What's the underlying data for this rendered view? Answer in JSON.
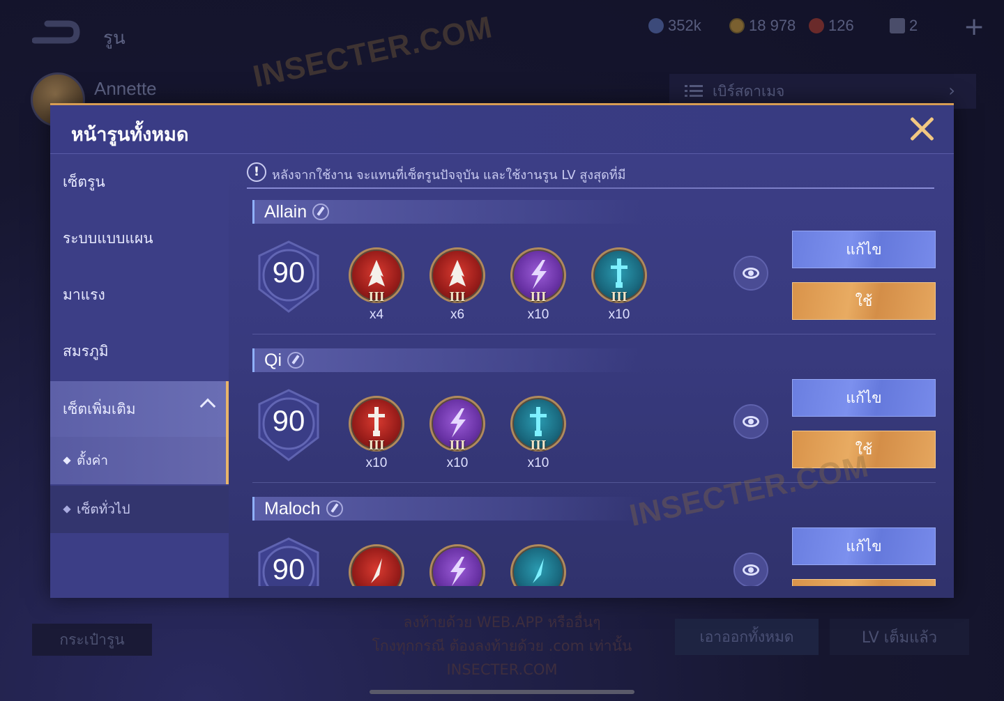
{
  "background": {
    "page_title": "รูน",
    "currencies": [
      {
        "icon": "crystal-icon",
        "value": "352k"
      },
      {
        "icon": "gold-coin-icon",
        "value": "18 978"
      },
      {
        "icon": "red-diamond-icon",
        "value": "126"
      },
      {
        "icon": "ticket-icon",
        "value": "2"
      }
    ],
    "plus_symbol": "+",
    "hero_name": "Annette",
    "mode_select_label": "เบิร์สดาเมจ",
    "bottom_left_button": "กระเป๋ารูน",
    "remove_all_button": "เอาออกทั้งหมด",
    "lv_full_button": "LV เต็มแล้ว",
    "notice_lines": [
      "ลงท้ายด้วย WEB.APP หรืออื่นๆ",
      "โกงทุกกรณี ต้องลงท้ายด้วย .com เท่านั้น",
      "INSECTER.COM"
    ],
    "watermark": "INSECTER.COM"
  },
  "modal": {
    "title": "หน้ารูนทั้งหมด",
    "sidebar": {
      "items": [
        {
          "label": "เซ็ตรูน"
        },
        {
          "label": "ระบบแบบแผน"
        },
        {
          "label": "มาแรง"
        },
        {
          "label": "สมรภูมิ"
        },
        {
          "label": "เซ็ตเพิ่มเติม"
        }
      ],
      "sub_items": [
        {
          "label": "ตั้งค่า"
        },
        {
          "label": "เซ็ตทั่วไป"
        }
      ]
    },
    "info_text": "หลังจากใช้งาน จะแทนที่เซ็ตรูนปัจจุบัน และใช้งานรูน LV สูงสุดที่มี",
    "edit_label": "แก้ไข",
    "use_label": "ใช้",
    "sets": [
      {
        "name": "Allain",
        "level": "90",
        "runes": [
          {
            "color": "red",
            "icon": "flame-icon",
            "tier": "III",
            "count": "x4"
          },
          {
            "color": "red",
            "icon": "flame-icon",
            "tier": "III",
            "count": "x6"
          },
          {
            "color": "purple",
            "icon": "lightning-icon",
            "tier": "III",
            "count": "x10"
          },
          {
            "color": "teal",
            "icon": "sword-icon",
            "tier": "III",
            "count": "x10"
          }
        ]
      },
      {
        "name": "Qi",
        "level": "90",
        "runes": [
          {
            "color": "red",
            "icon": "sword-icon",
            "tier": "III",
            "count": "x10"
          },
          {
            "color": "purple",
            "icon": "lightning-icon",
            "tier": "III",
            "count": "x10"
          },
          {
            "color": "teal",
            "icon": "sword-icon",
            "tier": "III",
            "count": "x10"
          }
        ]
      },
      {
        "name": "Maloch",
        "level": "90",
        "runes": [
          {
            "color": "red",
            "icon": "blade-icon",
            "tier": "",
            "count": ""
          },
          {
            "color": "purple",
            "icon": "lightning-icon",
            "tier": "",
            "count": ""
          },
          {
            "color": "teal",
            "icon": "blade-icon",
            "tier": "",
            "count": ""
          }
        ]
      }
    ]
  },
  "colors": {
    "accent_gold": "#d79d54",
    "edit_button_blue": "#7084e4",
    "use_button_orange": "#e2a15a",
    "modal_bg": "#3b3d84"
  }
}
